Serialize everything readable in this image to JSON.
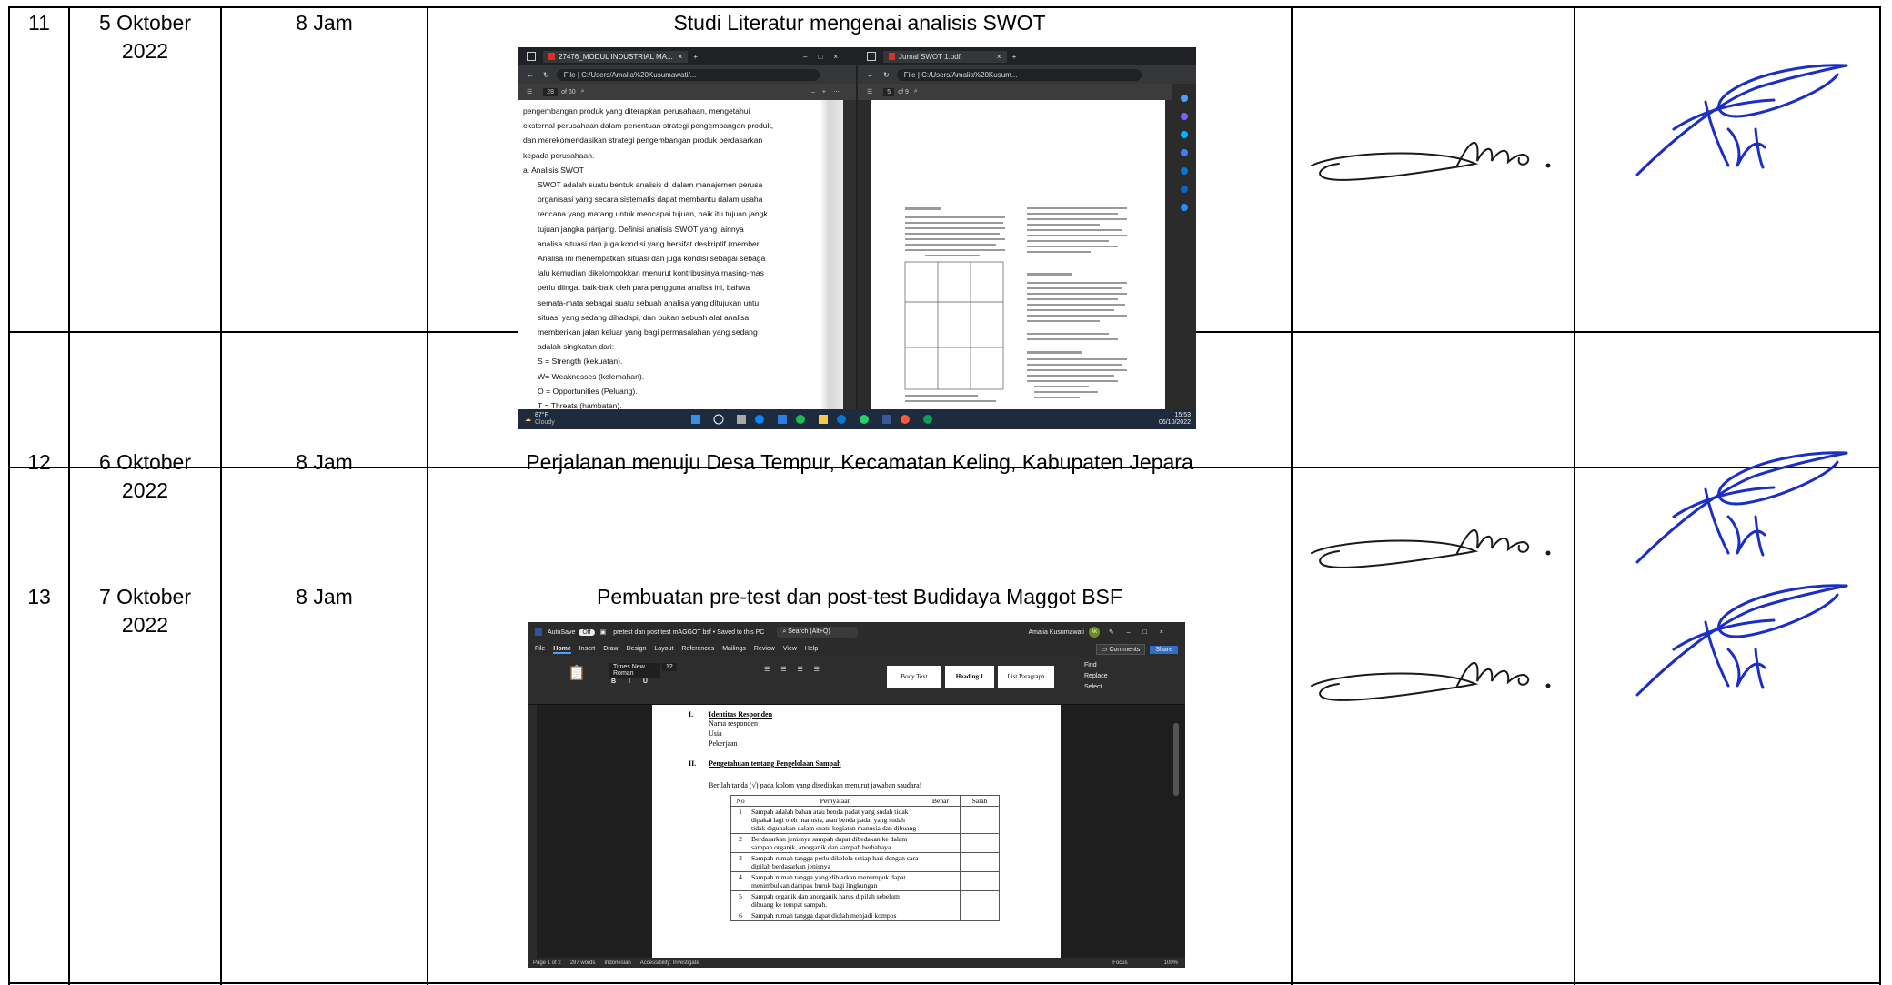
{
  "rows": [
    {
      "no": "11",
      "date": "5 Oktober\n2022",
      "duration": "8 Jam",
      "activity": "Studi Literatur mengenai analisis SWOT",
      "screenshot": {
        "left_tab": "27476_MODUL INDUSTRIAL MA...",
        "left_url": "File  |  C:/Users/Amalia%20Kusumawati/...",
        "left_page": "28",
        "left_of": "of 60",
        "right_tab": "Jurnal SWOT 1.pdf",
        "right_url": "File  |  C:/Users/Amalia%20Kusum...",
        "right_page": "5",
        "right_of": "of 9",
        "doc_lines": [
          "pengembangan produk yang diterapkan perusahaan, mengetahui",
          "eksternal perusahaan dalam penentuan strategi pengembangan produk,",
          "dan merekomendasikan strategi pengembangan produk berdasarkan",
          "kepada perusahaan.",
          "a.    Analisis SWOT",
          "SWOT adalah suatu bentuk analisis di dalam manajemen perusa",
          "organisasi yang secara sistematis dapat membantu dalam usaha",
          "rencana yang matang untuk mencapai tujuan, baik itu tujuan jangk",
          "tujuan jangka panjang. Definisi analisis SWOT yang lainnya",
          "analisa situasi dan juga kondisi yang bersifat deskriptif (memberi",
          "Analisa ini menempatkan situasi dan juga kondisi sebagai sebaga",
          "lalu kemudian dikelompokkan menurut kontribusinya masing-mas",
          "perlu diingat baik-baik oleh para pengguna analisa ini, bahwa",
          "semata-mata sebagai suatu sebuah analisa yang ditujukan untu",
          "situasi yang sedang dihadapi, dan bukan     sebuah alat analisa",
          "memberikan jalan keluar yang bagi permasalahan yang sedang",
          "adalah singkatan dari:",
          "S = Strength (kekuatan).",
          "W= Weaknesses (kelemahan).",
          "O = Opportunities (Peluang).",
          "T = Threats (hambatan)."
        ],
        "weather_temp": "87°F",
        "weather_desc": "Cloudy",
        "clock_time": "15:53",
        "clock_date": "06/10/2022"
      }
    },
    {
      "no": "12",
      "date": "6 Oktober\n2022",
      "duration": "8 Jam",
      "activity": "Perjalanan menuju Desa Tempur, Kecamatan Keling, Kabupaten Jepara"
    },
    {
      "no": "13",
      "date": "7 Oktober\n2022",
      "duration": "8 Jam",
      "activity": "Pembuatan pre-test dan post-test Budidaya Maggot BSF",
      "screenshot": {
        "autosave": "AutoSave",
        "autosave_state": "Off",
        "doc_title": "pretest dan post test mAGGOT bsf • Saved to this PC",
        "search": "Search (Alt+Q)",
        "user": "Amalia Kusumawati",
        "user_initials": "AK",
        "menu": [
          "File",
          "Home",
          "Insert",
          "Draw",
          "Design",
          "Layout",
          "References",
          "Mailings",
          "Review",
          "View",
          "Help"
        ],
        "comments": "Comments",
        "share": "Share",
        "font_name": "Times New Roman",
        "font_size": "12",
        "styles": [
          "Body Text",
          "Heading 1",
          "List Paragraph"
        ],
        "find": "Find",
        "replace": "Replace",
        "select": "Select",
        "section1_num": "I.",
        "section1_title": "Identitas Responden",
        "fields": [
          "Nama responden",
          "Usia",
          "Pekerjaan"
        ],
        "section2_num": "II.",
        "section2_title": "Pengetahuan tentang Pengelolaan Sampah",
        "instruction": "Berilah tanda (√) pada kolom yang disediakan menurut jawaban saudara!",
        "table_headers": [
          "No",
          "Pernyataan",
          "Benar",
          "Salah"
        ],
        "statements": [
          {
            "no": "1",
            "text": "Sampah adalah bahan atau benda padat yang sudah tidak dipakai lagi oleh manusia, atau benda padat yang sudah tidak digunakan dalam suatu kegiatan manusia dan dibuang"
          },
          {
            "no": "2",
            "text": "Berdasarkan jenisnya sampah dapat dibedakan ke dalam sampah organik, anorganik dan sampah berbahaya"
          },
          {
            "no": "3",
            "text": "Sampah rumah tangga perlu dikelola setiap hari dengan cara dipilah berdasarkan jenisnya"
          },
          {
            "no": "4",
            "text": "Sampah rumah tangga yang dibiarkan menumpuk dapat menimbulkan dampak buruk bagi lingkungan"
          },
          {
            "no": "5",
            "text": "Sampah organik dan anorganik harus dipilah sebelum dibuang ke tempat sampah."
          },
          {
            "no": "6",
            "text": "Sampah rumah tangga dapat diolah menjadi kompos"
          }
        ],
        "status_page": "Page 1 of 2",
        "status_words": "297 words",
        "status_lang": "Indonesian",
        "status_access": "Accessibility: Investigate",
        "status_focus": "Focus",
        "status_zoom": "100%"
      }
    }
  ],
  "colors": {
    "table_line": "#000000",
    "signature_ink": "#1b2fc4",
    "paraf_ink": "#1a1a1a",
    "dark_ui": "#202124",
    "word_blue": "#2b579a",
    "taskbar": "#1e2b3c"
  }
}
